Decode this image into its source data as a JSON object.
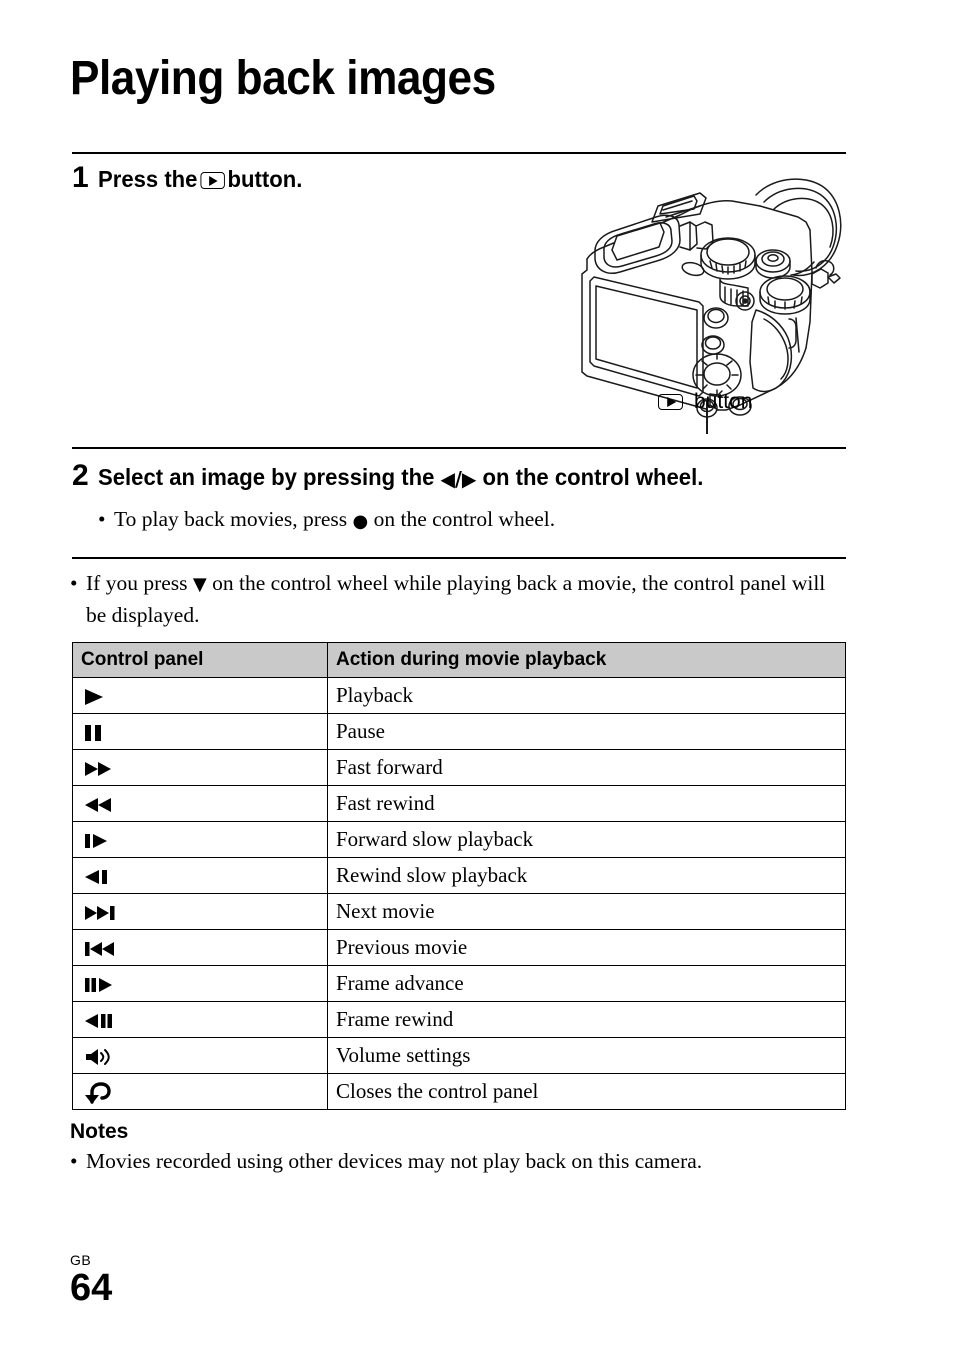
{
  "document": {
    "title": "Playing back images",
    "footer": {
      "region_code": "GB",
      "page_number": "64"
    }
  },
  "steps": [
    {
      "number": "1",
      "text_before": "Press the",
      "icon": "playback-button-icon",
      "text_after": "button."
    },
    {
      "number": "2",
      "text_before": "Select an image by pressing the",
      "arrows": "◀/▶",
      "text_after": "on the control wheel.",
      "bullets": [
        {
          "before": "To play back movies, press",
          "glyph": "●",
          "after": "on the control wheel."
        }
      ]
    }
  ],
  "figure": {
    "name": "camera-rear-illustration",
    "callout": {
      "icon": "playback-button-icon",
      "label": "button"
    }
  },
  "intro_note": {
    "bullet": "•",
    "before": "If you press",
    "glyph": "▼",
    "after": "on the control wheel while playing back a movie, the control panel will be displayed."
  },
  "table": {
    "headers": [
      "Control panel",
      "Action during movie playback"
    ],
    "rows": [
      {
        "icon_name": "play-icon",
        "icon_text": "▶",
        "action": "Playback"
      },
      {
        "icon_name": "pause-icon",
        "icon_text": "██",
        "action": "Pause"
      },
      {
        "icon_name": "fast-forward-icon",
        "icon_text": "▶▶",
        "action": "Fast forward"
      },
      {
        "icon_name": "fast-rewind-icon",
        "icon_text": "◀◀",
        "action": "Fast rewind"
      },
      {
        "icon_name": "slow-forward-icon",
        "icon_text": "▐▶",
        "action": "Forward slow playback"
      },
      {
        "icon_name": "slow-rewind-icon",
        "icon_text": "◀▌",
        "action": "Rewind slow playback"
      },
      {
        "icon_name": "next-movie-icon",
        "icon_text": "▶▶▐",
        "action": "Next movie"
      },
      {
        "icon_name": "previous-movie-icon",
        "icon_text": "▌◀◀",
        "action": "Previous movie"
      },
      {
        "icon_name": "frame-advance-icon",
        "icon_text": "██▶",
        "action": "Frame advance"
      },
      {
        "icon_name": "frame-rewind-icon",
        "icon_text": "◀██",
        "action": "Frame rewind"
      },
      {
        "icon_name": "volume-icon",
        "icon_text": "🔈",
        "action": "Volume settings"
      },
      {
        "icon_name": "return-icon",
        "icon_text": "↩",
        "action": "Closes the control panel"
      }
    ]
  },
  "notes": {
    "heading": "Notes",
    "items": [
      {
        "bullet": "•",
        "text": "Movies recorded using other devices may not play back on this camera."
      }
    ]
  },
  "colors": {
    "table_header_bg": "#c9c9c9",
    "rule": "#000000",
    "text": "#000000",
    "page_bg": "#ffffff"
  }
}
